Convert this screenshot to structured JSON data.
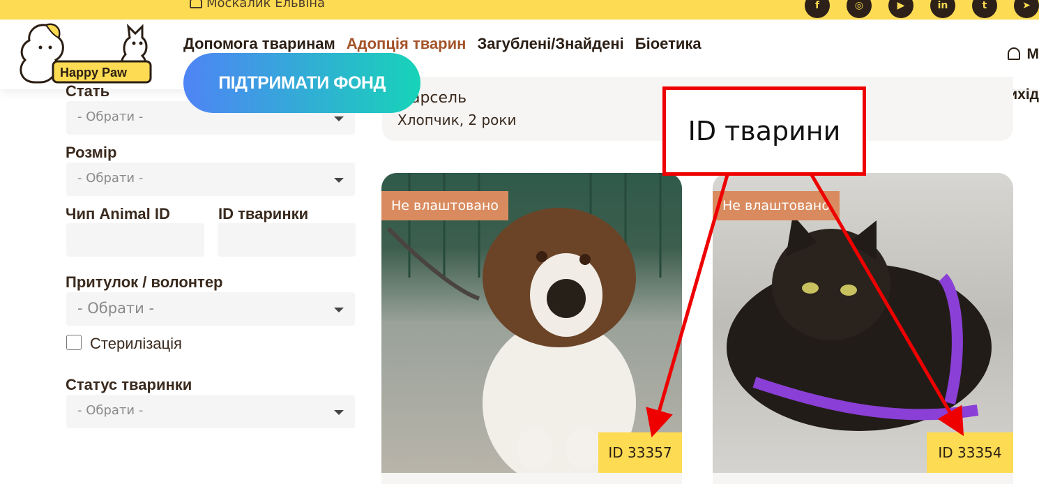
{
  "header": {
    "top_user_name": "Москалик Ельвіна",
    "logo_text": "Happy Paw",
    "nav": [
      {
        "label": "Допомога тваринам",
        "active": false
      },
      {
        "label": "Адопція тварин",
        "active": true
      },
      {
        "label": "Загублені/Знайдені",
        "active": false
      },
      {
        "label": "Біоетика",
        "active": false
      }
    ],
    "support_button": "ПІДТРИМАТИ ФОНД",
    "account_label": "М",
    "logout_label": "Вихід",
    "socials": [
      "facebook-icon",
      "instagram-icon",
      "youtube-icon",
      "linkedin-icon",
      "twitter-icon",
      "telegram-icon"
    ]
  },
  "filters": {
    "sex_label": "Стать",
    "sex_placeholder": "- Обрати -",
    "size_label": "Розмір",
    "size_placeholder": "- Обрати -",
    "chip_label": "Чип Animal ID",
    "animal_id_label": "ID тваринки",
    "shelter_label": "Притулок / волонтер",
    "shelter_placeholder": "- Обрати -",
    "sterilization_label": "Стерилізація",
    "status_label": "Статус тваринки",
    "status_placeholder": "- Обрати -"
  },
  "results": {
    "top_card": {
      "name": "Марсель",
      "desc": "Хлопчик, 2 роки"
    },
    "cards": [
      {
        "status": "Не влаштовано",
        "id": "ID 33357",
        "animal": "dog"
      },
      {
        "status": "Не влаштовано",
        "id": "ID 33354",
        "animal": "cat"
      }
    ]
  },
  "annotation": {
    "label": "ID тварини",
    "color": "#ee0000"
  },
  "colors": {
    "brand_yellow": "#fddb52",
    "active_nav": "#a4542a",
    "badge": "#d98b5f"
  }
}
